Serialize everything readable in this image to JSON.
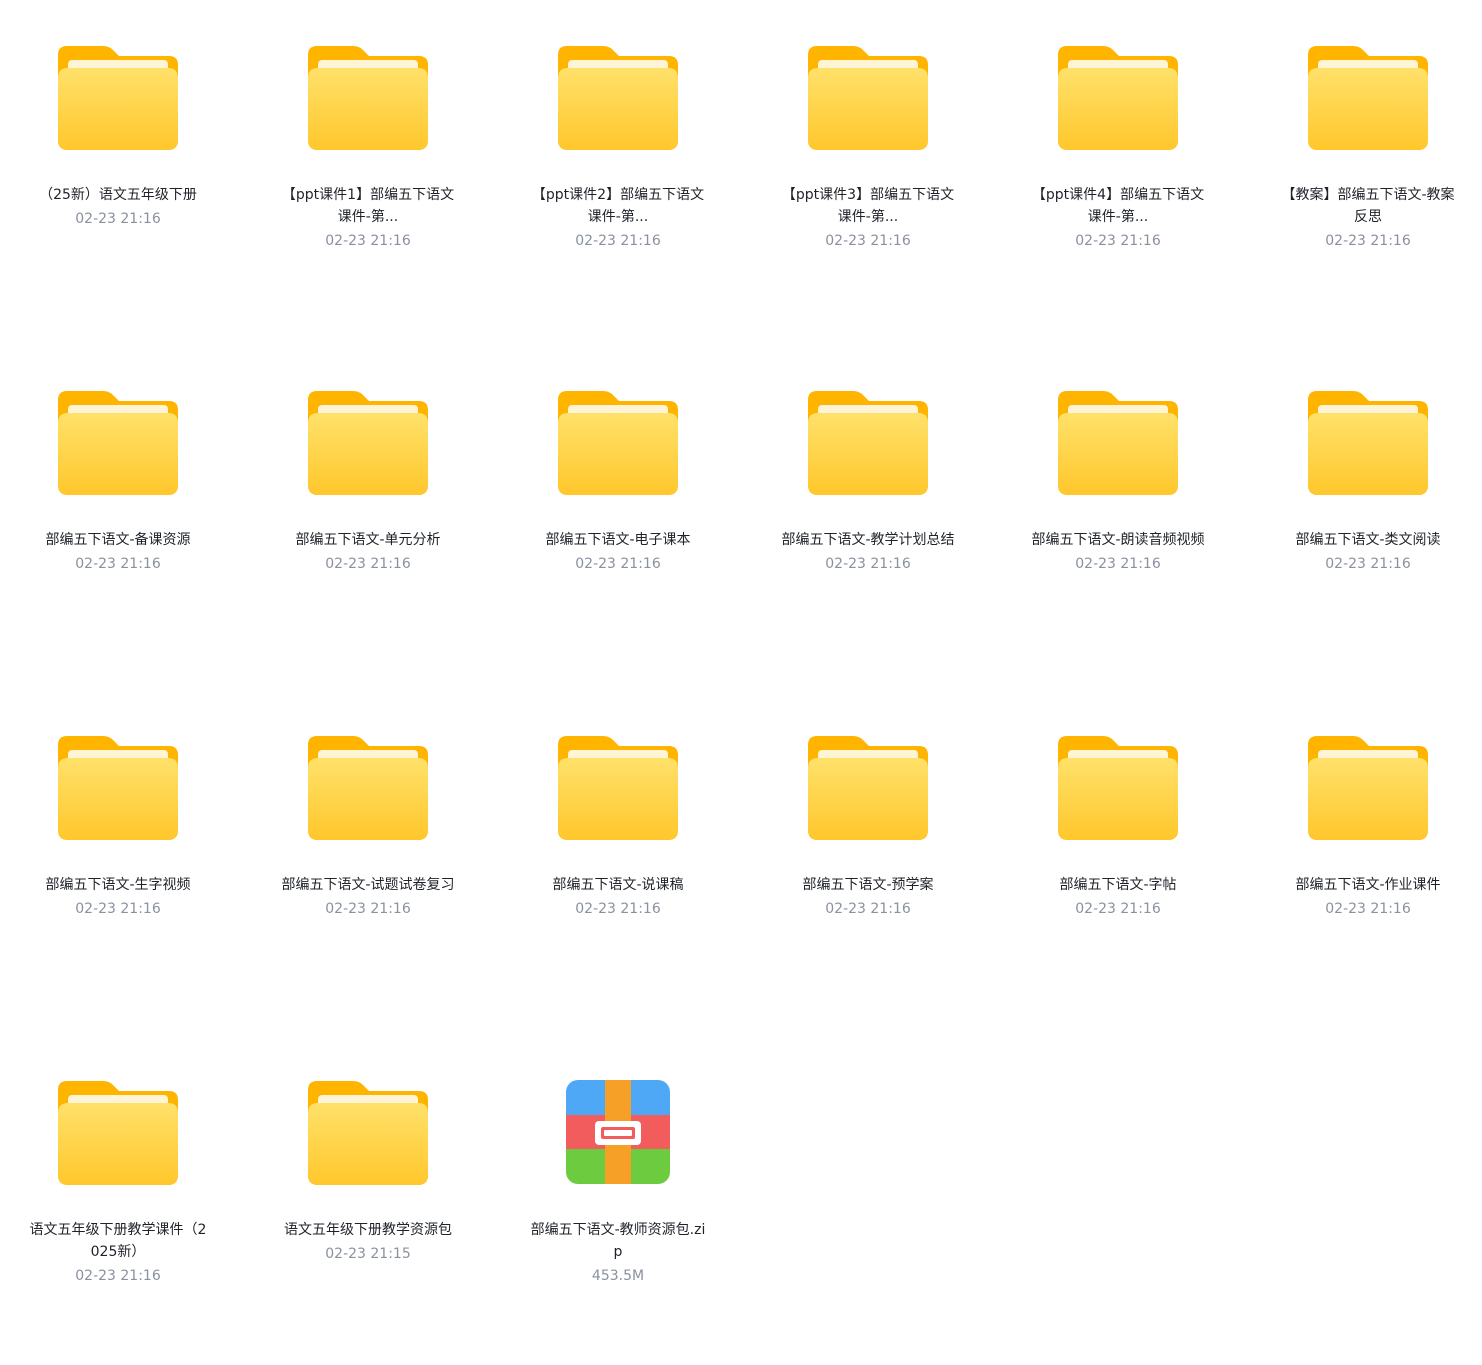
{
  "colors": {
    "folder_back": "#FFB400",
    "folder_front_top": "#FFE16A",
    "folder_front_bottom": "#FFC72C",
    "folder_paper": "#FFF4D6",
    "name_text": "#1F2329",
    "meta_text": "#8A919F"
  },
  "items": [
    {
      "type": "folder",
      "icon": "folder-icon",
      "name": "（25新）语文五年级下册",
      "meta": "02-23 21:16"
    },
    {
      "type": "folder",
      "icon": "folder-icon",
      "name": "【ppt课件1】部编五下语文课件-第...",
      "meta": "02-23 21:16"
    },
    {
      "type": "folder",
      "icon": "folder-icon",
      "name": "【ppt课件2】部编五下语文课件-第...",
      "meta": "02-23 21:16"
    },
    {
      "type": "folder",
      "icon": "folder-icon",
      "name": "【ppt课件3】部编五下语文课件-第...",
      "meta": "02-23 21:16"
    },
    {
      "type": "folder",
      "icon": "folder-icon",
      "name": "【ppt课件4】部编五下语文课件-第...",
      "meta": "02-23 21:16"
    },
    {
      "type": "folder",
      "icon": "folder-icon",
      "name": "【教案】部编五下语文-教案反思",
      "meta": "02-23 21:16"
    },
    {
      "type": "folder",
      "icon": "folder-icon",
      "name": "部编五下语文-备课资源",
      "meta": "02-23 21:16"
    },
    {
      "type": "folder",
      "icon": "folder-icon",
      "name": "部编五下语文-单元分析",
      "meta": "02-23 21:16"
    },
    {
      "type": "folder",
      "icon": "folder-icon",
      "name": "部编五下语文-电子课本",
      "meta": "02-23 21:16"
    },
    {
      "type": "folder",
      "icon": "folder-icon",
      "name": "部编五下语文-教学计划总结",
      "meta": "02-23 21:16"
    },
    {
      "type": "folder",
      "icon": "folder-icon",
      "name": "部编五下语文-朗读音频视频",
      "meta": "02-23 21:16"
    },
    {
      "type": "folder",
      "icon": "folder-icon",
      "name": "部编五下语文-类文阅读",
      "meta": "02-23 21:16"
    },
    {
      "type": "folder",
      "icon": "folder-icon",
      "name": "部编五下语文-生字视频",
      "meta": "02-23 21:16"
    },
    {
      "type": "folder",
      "icon": "folder-icon",
      "name": "部编五下语文-试题试卷复习",
      "meta": "02-23 21:16"
    },
    {
      "type": "folder",
      "icon": "folder-icon",
      "name": "部编五下语文-说课稿",
      "meta": "02-23 21:16"
    },
    {
      "type": "folder",
      "icon": "folder-icon",
      "name": "部编五下语文-预学案",
      "meta": "02-23 21:16"
    },
    {
      "type": "folder",
      "icon": "folder-icon",
      "name": "部编五下语文-字帖",
      "meta": "02-23 21:16"
    },
    {
      "type": "folder",
      "icon": "folder-icon",
      "name": "部编五下语文-作业课件",
      "meta": "02-23 21:16"
    },
    {
      "type": "folder",
      "icon": "folder-icon",
      "name": "语文五年级下册教学课件（2025新）",
      "meta": "02-23 21:16"
    },
    {
      "type": "folder",
      "icon": "folder-icon",
      "name": "语文五年级下册教学资源包",
      "meta": "02-23 21:15"
    },
    {
      "type": "archive",
      "icon": "zip-archive-icon",
      "name": "部编五下语文-教师资源包.zip",
      "meta": "453.5M"
    }
  ]
}
